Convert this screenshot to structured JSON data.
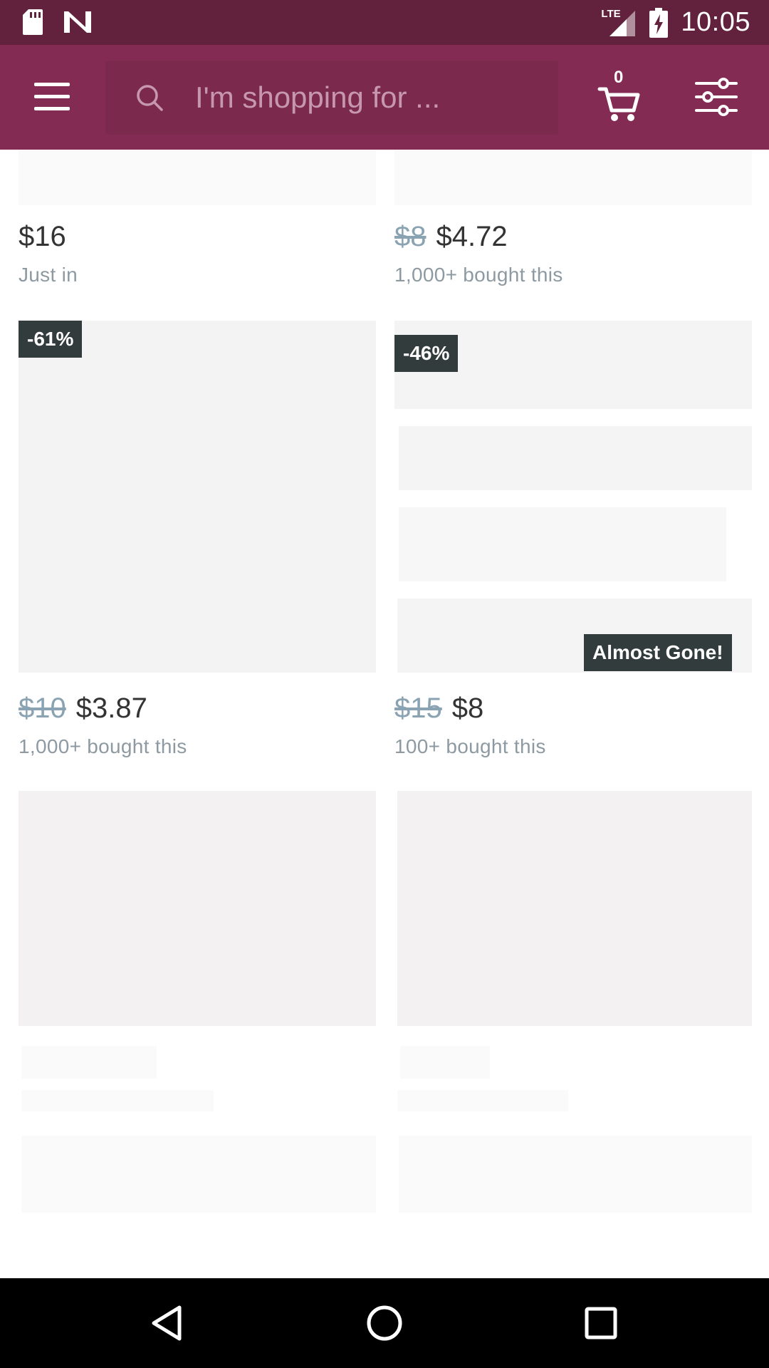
{
  "status_bar": {
    "time": "10:05",
    "network": "LTE",
    "icons": [
      "sd-card-icon",
      "n-notification-icon",
      "lte-signal-icon",
      "battery-charging-icon"
    ]
  },
  "app_bar": {
    "search_placeholder": "I'm shopping for ...",
    "cart_count": "0",
    "icons": [
      "menu-icon",
      "search-icon",
      "cart-icon",
      "filter-icon"
    ],
    "colors": {
      "status_bar": "#62213c",
      "app_bar": "#832b53"
    }
  },
  "products": [
    {
      "old_price": "",
      "price": "$16",
      "subtitle": "Just in",
      "badge": ""
    },
    {
      "old_price": "$8",
      "price": "$4.72",
      "subtitle": "1,000+ bought this",
      "badge": ""
    },
    {
      "old_price": "$10",
      "price": "$3.87",
      "subtitle": "1,000+ bought this",
      "badge": "-61%"
    },
    {
      "old_price": "$15",
      "price": "$8",
      "subtitle": "100+ bought this",
      "badge": "-46%",
      "badge_secondary": "Almost Gone!"
    }
  ],
  "nav_bar": {
    "icons": [
      "back-icon",
      "home-icon",
      "recents-icon"
    ]
  }
}
